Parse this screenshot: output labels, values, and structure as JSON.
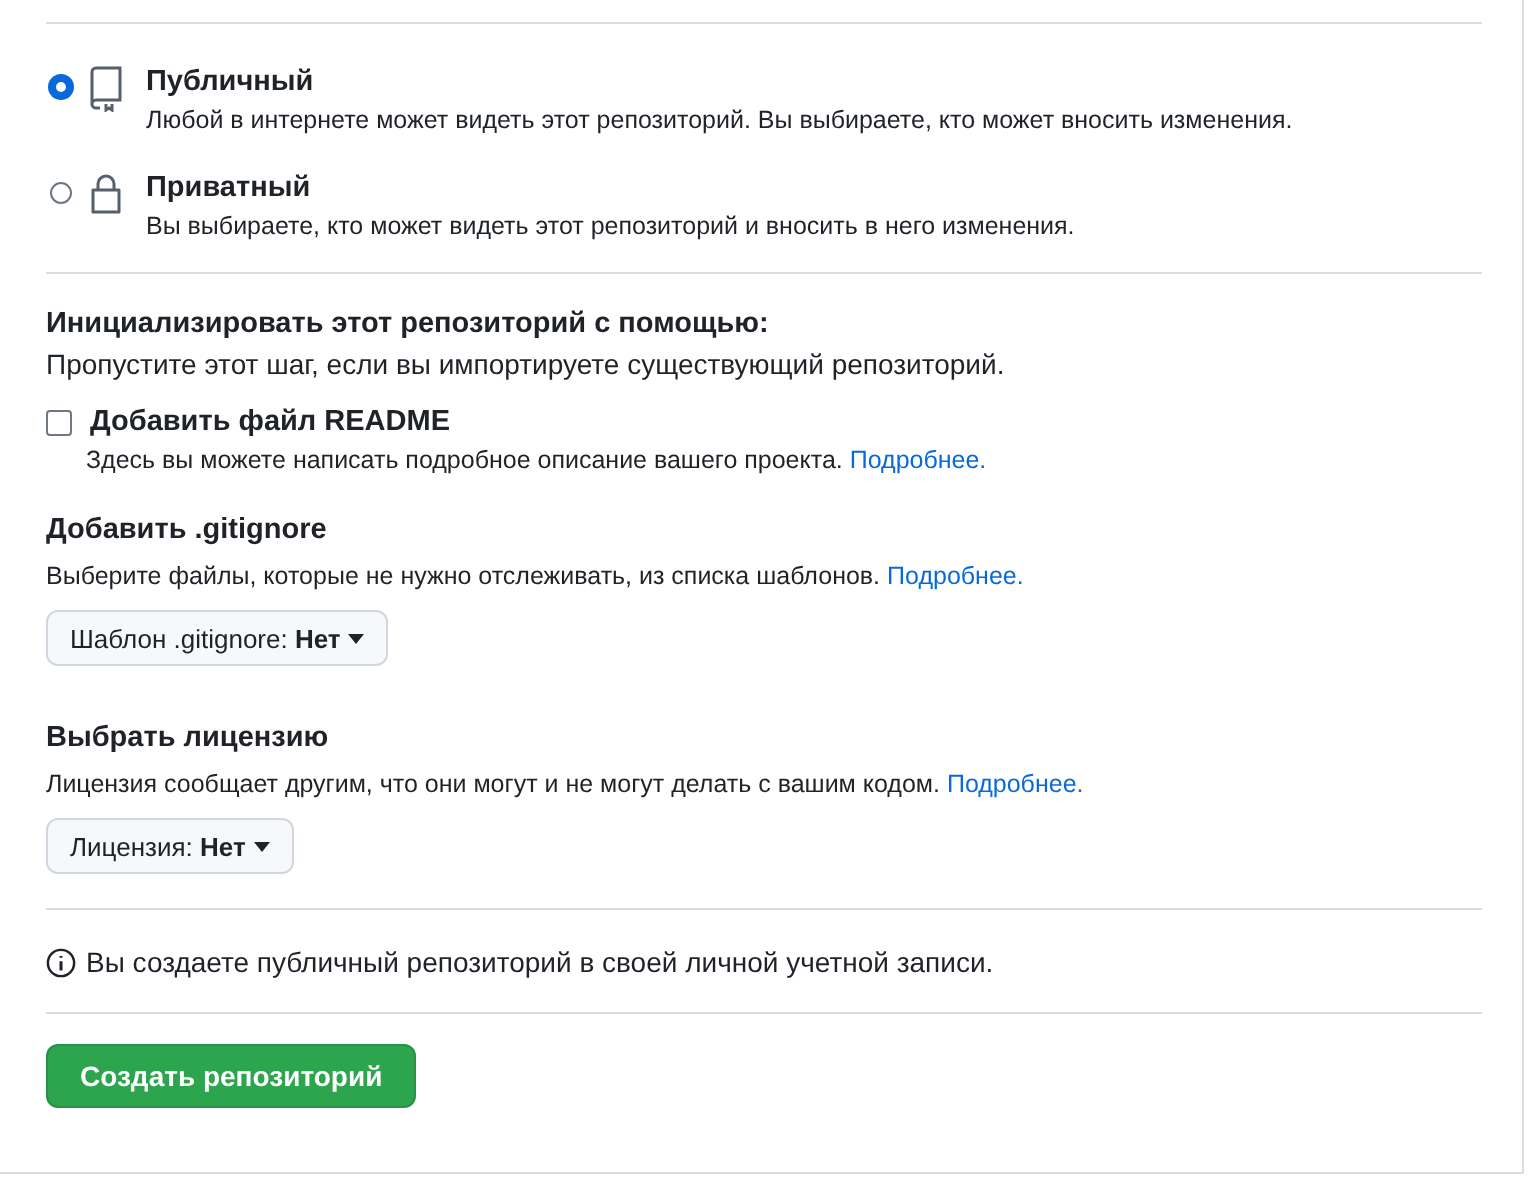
{
  "visibility": [
    {
      "kind": "public",
      "title": "Публичный",
      "description": "Любой в интернете может видеть этот репозиторий. Вы выбираете, кто может вносить изменения.",
      "selected": true
    },
    {
      "kind": "private",
      "title": "Приватный",
      "description": "Вы выбираете, кто может видеть этот репозиторий и вносить в него изменения.",
      "selected": false
    }
  ],
  "initialize": {
    "heading": "Инициализировать этот репозиторий с помощью:",
    "description": "Пропустите этот шаг, если вы импортируете существующий репозиторий."
  },
  "readme": {
    "label": "Добавить файл README",
    "checked": false,
    "description": "Здесь вы можете написать подробное описание вашего проекта.",
    "link": "Подробнее."
  },
  "gitignore": {
    "heading": "Добавить .gitignore",
    "description": "Выберите файлы, которые не нужно отслеживать, из списка шаблонов.",
    "link": "Подробнее.",
    "dropdown_label": "Шаблон .gitignore:",
    "dropdown_value": "Нет"
  },
  "license": {
    "heading": "Выбрать лицензию",
    "description": "Лицензия сообщает другим, что они могут и не могут делать с вашим кодом.",
    "link": "Подробнее.",
    "dropdown_label": "Лицензия:",
    "dropdown_value": "Нет"
  },
  "notice": "Вы создаете публичный репозиторий в своей личной учетной записи.",
  "submit": "Создать репозиторий"
}
